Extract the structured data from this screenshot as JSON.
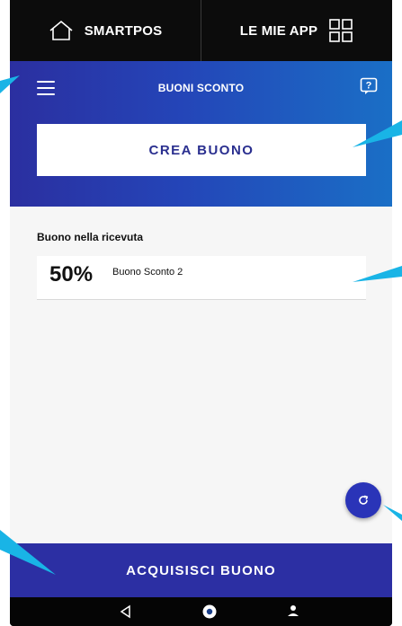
{
  "topbar": {
    "home_label": "SMARTPOS",
    "apps_label": "LE MIE APP"
  },
  "header": {
    "title": "BUONI SCONTO",
    "create_button": "CREA BUONO"
  },
  "content": {
    "section_label": "Buono nella ricevuta",
    "voucher": {
      "percent": "50%",
      "name": "Buono Sconto 2"
    }
  },
  "footer": {
    "acquire_button": "ACQUISISCI BUONO"
  },
  "colors": {
    "brand_blue": "#2c2fa3",
    "gradient_end": "#1a6fc6",
    "callout_cyan": "#19b4e6"
  },
  "icons": [
    "home-icon",
    "apps-grid-icon",
    "hamburger-menu-icon",
    "help-icon",
    "refresh-icon",
    "back-icon",
    "home-nav-icon",
    "user-icon"
  ]
}
